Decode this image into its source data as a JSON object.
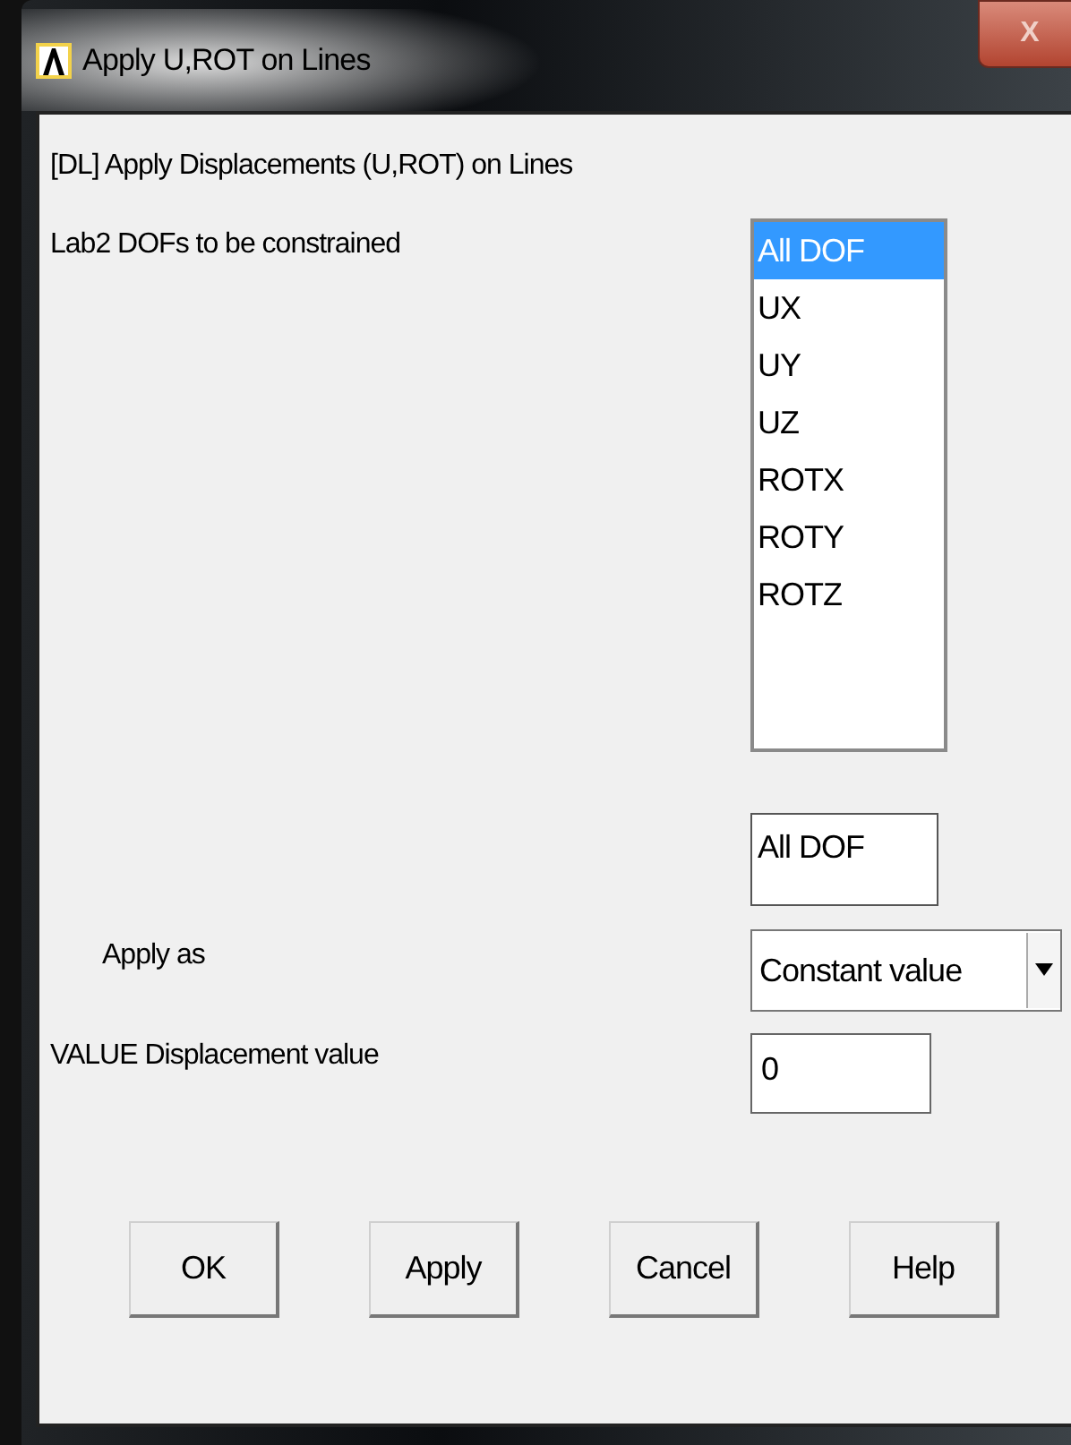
{
  "window": {
    "title": "Apply U,ROT on Lines",
    "close": "X"
  },
  "heading": "[DL]  Apply Displacements (U,ROT) on Lines",
  "dofs": {
    "label": "Lab2    DOFs to be constrained",
    "items": [
      {
        "label": "All DOF",
        "selected": true
      },
      {
        "label": "UX",
        "selected": false
      },
      {
        "label": "UY",
        "selected": false
      },
      {
        "label": "UZ",
        "selected": false
      },
      {
        "label": "ROTX",
        "selected": false
      },
      {
        "label": "ROTY",
        "selected": false
      },
      {
        "label": "ROTZ",
        "selected": false
      }
    ],
    "selection": "All DOF"
  },
  "apply_as": {
    "label": "Apply as",
    "value": "Constant value"
  },
  "value": {
    "label": "VALUE   Displacement value",
    "value": "0"
  },
  "buttons": [
    "OK",
    "Apply",
    "Cancel",
    "Help"
  ]
}
